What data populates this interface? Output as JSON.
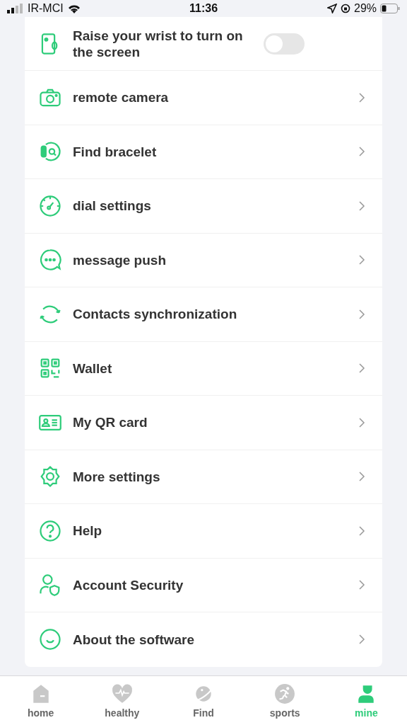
{
  "status_bar": {
    "carrier": "IR-MCI",
    "time": "11:36",
    "battery": "29%"
  },
  "settings": [
    {
      "kind": "toggle",
      "label": "Raise your wrist to turn on the screen",
      "on": false
    },
    {
      "kind": "link",
      "label": "remote camera"
    },
    {
      "kind": "link",
      "label": "Find bracelet"
    },
    {
      "kind": "link",
      "label": "dial settings"
    },
    {
      "kind": "link",
      "label": "message push"
    },
    {
      "kind": "link",
      "label": "Contacts synchronization"
    },
    {
      "kind": "link",
      "label": "Wallet"
    },
    {
      "kind": "link",
      "label": "My QR card"
    },
    {
      "kind": "link",
      "label": "More settings"
    },
    {
      "kind": "link",
      "label": "Help"
    },
    {
      "kind": "link",
      "label": "Account Security"
    },
    {
      "kind": "link",
      "label": "About the software"
    }
  ],
  "tabs": [
    {
      "label": "home",
      "selected": false
    },
    {
      "label": "healthy",
      "selected": false
    },
    {
      "label": "Find",
      "selected": false
    },
    {
      "label": "sports",
      "selected": false
    },
    {
      "label": "mine",
      "selected": true
    }
  ]
}
